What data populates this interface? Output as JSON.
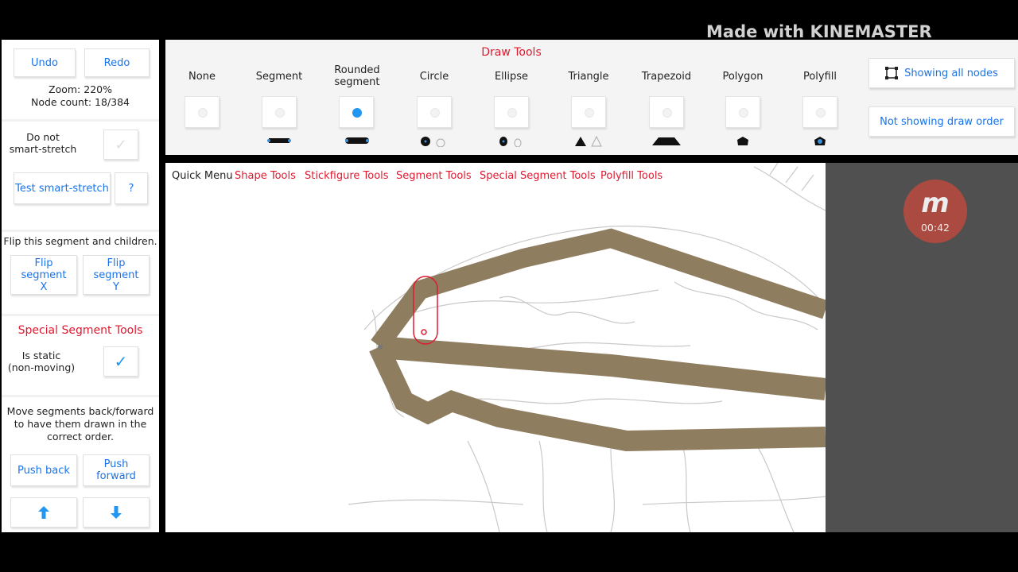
{
  "sidebar": {
    "undo": "Undo",
    "redo": "Redo",
    "zoom": "Zoom: 220%",
    "node_count": "Node count: 18/384",
    "smart_stretch_label_1": "Do not",
    "smart_stretch_label_2": "smart-stretch",
    "test_smart_stretch": "Test smart-stretch",
    "help": "?",
    "flip_info": "Flip this segment and children.",
    "flip_x_1": "Flip segment",
    "flip_x_2": "X",
    "flip_y_1": "Flip segment",
    "flip_y_2": "Y",
    "special_title": "Special Segment Tools",
    "is_static_1": "Is static",
    "is_static_2": "(non-moving)",
    "order_info": "Move segments back/forward to have them drawn in the correct order.",
    "push_back": "Push back",
    "push_forward": "Push forward"
  },
  "toolbar": {
    "title": "Draw Tools",
    "tools": [
      {
        "name": "None"
      },
      {
        "name": "Segment"
      },
      {
        "name": "Rounded segment",
        "selected": true
      },
      {
        "name": "Circle"
      },
      {
        "name": "Ellipse"
      },
      {
        "name": "Triangle"
      },
      {
        "name": "Trapezoid"
      },
      {
        "name": "Polygon"
      },
      {
        "name": "Polyfill"
      }
    ],
    "showing_nodes": "Showing all nodes",
    "not_showing_order": "Not showing draw order"
  },
  "watermark": "Made with KINEMASTER",
  "timer": "00:42",
  "quick_menu": {
    "label": "Quick Menu",
    "links": [
      "Shape Tools",
      "Stickfigure Tools",
      "Segment Tools",
      "Special Segment Tools",
      "Polyfill Tools"
    ]
  },
  "colors": {
    "accent_blue": "#1a73e8",
    "accent_red": "#e0192f",
    "segment_fill": "#8f7d60",
    "selected_radio": "#2196f3"
  }
}
